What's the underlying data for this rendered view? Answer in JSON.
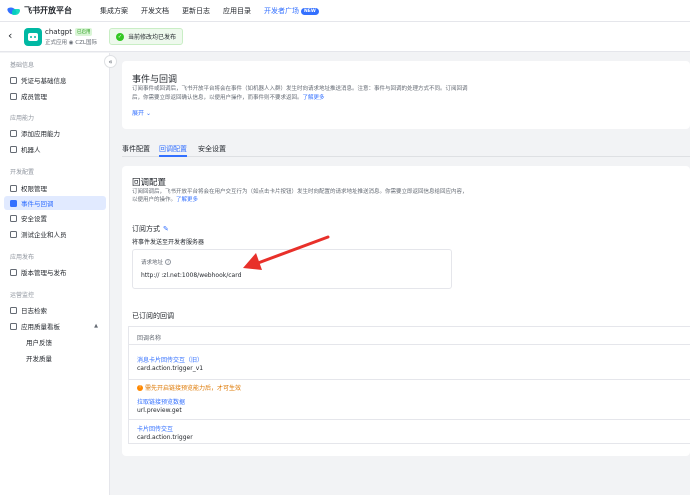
{
  "topbar": {
    "brand": "飞书开放平台",
    "nav": [
      "集成方案",
      "开发文档",
      "更新日志",
      "应用目录",
      "开发者广场"
    ],
    "new_badge": "NEW"
  },
  "app": {
    "name": "chatgpt",
    "status": "已启用",
    "subtitle": "正式应用 ◉ CZL国际",
    "published": "当前修改均已发布"
  },
  "sidebar": {
    "sections": [
      {
        "title": "基础信息",
        "items": [
          "凭证与基础信息",
          "成员管理"
        ]
      },
      {
        "title": "应用能力",
        "items": [
          "添加应用能力",
          "机器人"
        ]
      },
      {
        "title": "开发配置",
        "items": [
          "权限管理",
          "事件与回调",
          "安全设置",
          "测试企业和人员"
        ]
      },
      {
        "title": "应用发布",
        "items": [
          "版本管理与发布"
        ]
      },
      {
        "title": "运营监控",
        "items": [
          "日志检索",
          "应用质量看板",
          "用户反馈",
          "开发质量"
        ]
      }
    ]
  },
  "main": {
    "title": "事件与回调",
    "desc": "订阅事件或回调后，飞书开放平台将会在事件（如机器人入群）发生时向请求地址推送消息。注意：事件与回调的处理方式不同。订阅回调后，你需要立即返回确认信息，以便用户操作，而事件则不要求返回。",
    "desc_link": "了解更多",
    "expand": "展开",
    "tabs": [
      "事件配置",
      "回调配置",
      "安全设置"
    ],
    "callback": {
      "title": "回调配置",
      "desc": "订阅回调后，飞书开放平台将会在用户交互行为（如点击卡片按钮）发生时向配置的请求地址推送消息。你需要立即返回信息给回应内容，以便用户的操作。",
      "desc_link": "了解更多",
      "method_label": "订阅方式",
      "method_value": "将事件发送至开发者服务器",
      "url_label": "请求地址",
      "url_value": "http://         :zl.net:1008/webhook/card",
      "subscribed_title": "已订阅的回调",
      "table_header": "回调名称",
      "rows": [
        {
          "name": "消息卡片回传交互（旧）",
          "code": "card.action.trigger_v1",
          "warning": ""
        },
        {
          "name": "拉取链接预览数据",
          "code": "url.preview.get",
          "warning": "需先开启链接预览能力后，才可生效"
        },
        {
          "name": "卡片回传交互",
          "code": "card.action.trigger",
          "warning": ""
        }
      ]
    }
  },
  "colors": {
    "accent": "#3370ff",
    "arrow": "#e8302a",
    "warning": "#de7802"
  }
}
